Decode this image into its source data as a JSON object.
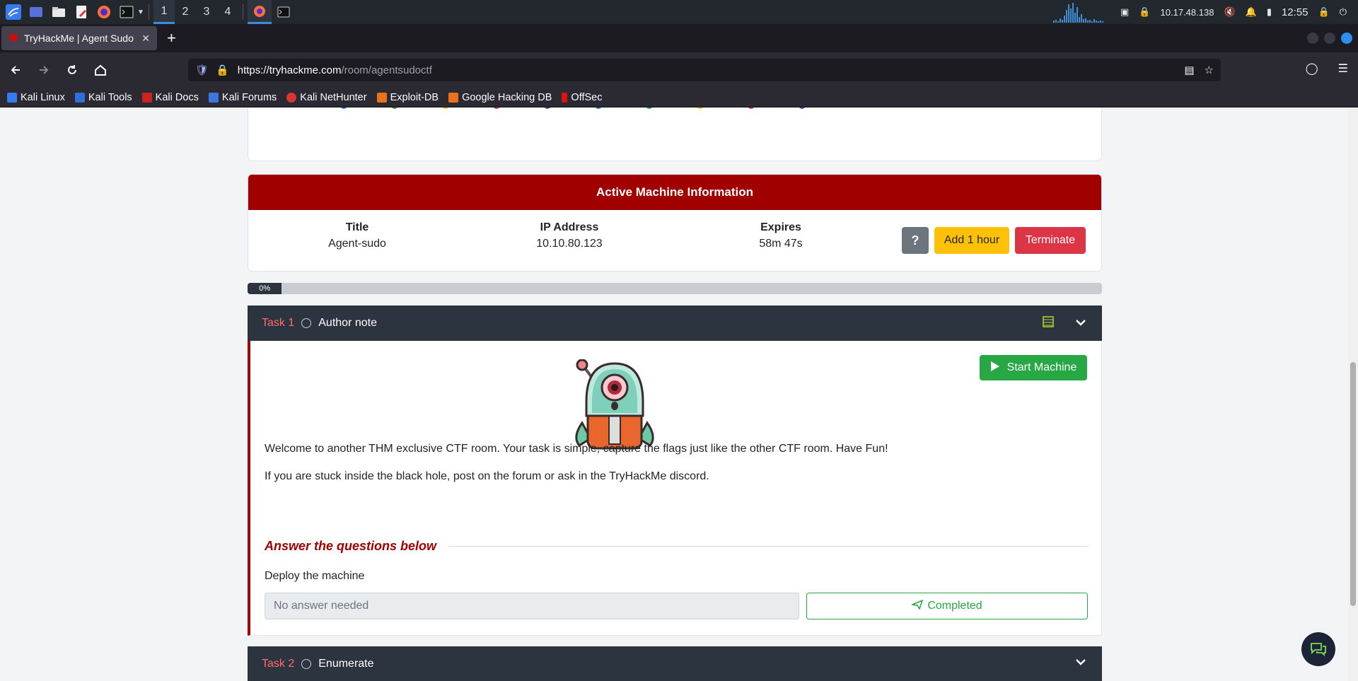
{
  "taskbar": {
    "workspaces": [
      "1",
      "2",
      "3",
      "4"
    ],
    "ip": "10.17.48.138",
    "clock": "12:55"
  },
  "browser": {
    "tab_title": "TryHackMe | Agent Sudo",
    "url_host": "https://tryhackme.com",
    "url_path": "/room/agentsudoctf",
    "bookmarks": [
      "Kali Linux",
      "Kali Tools",
      "Kali Docs",
      "Kali Forums",
      "Kali NetHunter",
      "Exploit-DB",
      "Google Hacking DB",
      "OffSec"
    ]
  },
  "machine": {
    "header": "Active Machine Information",
    "title_label": "Title",
    "title_value": "Agent-sudo",
    "ip_label": "IP Address",
    "ip_value": "10.10.80.123",
    "expires_label": "Expires",
    "expires_value": "58m 47s",
    "help_label": "?",
    "add_hour_label": "Add 1 hour",
    "terminate_label": "Terminate"
  },
  "progress": {
    "percent": 0,
    "label": "0%"
  },
  "tasks": [
    {
      "number": "Task 1",
      "title": "Author note",
      "start_machine_label": "Start Machine",
      "paragraphs": [
        "Welcome to another THM exclusive CTF room. Your task is simple, capture the flags just like the other CTF room. Have Fun!",
        "If you are stuck inside the black hole, post on the forum or ask in the TryHackMe discord."
      ],
      "answer_heading": "Answer the questions below",
      "question": "Deploy the machine",
      "answer_placeholder": "No answer needed",
      "completed_label": "Completed"
    },
    {
      "number": "Task 2",
      "title": "Enumerate"
    }
  ],
  "colors": {
    "brand_red": "#a10000",
    "task_dark": "#2c3440",
    "success": "#28a745",
    "warning": "#ffc107",
    "danger": "#dc3545"
  }
}
